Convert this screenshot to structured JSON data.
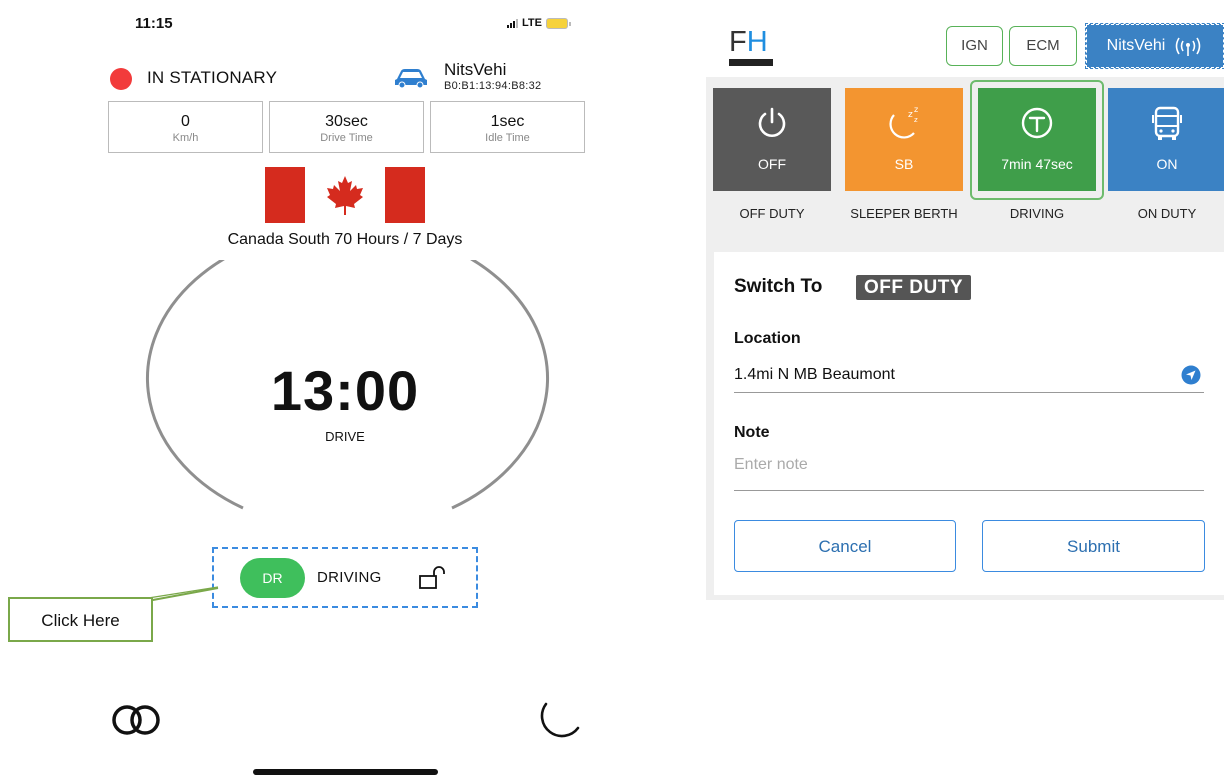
{
  "phone": {
    "status_bar": {
      "time": "11:15",
      "network": "LTE"
    },
    "vehicle_status": "IN STATIONARY",
    "vehicle": {
      "name": "NitsVehi",
      "mac": "B0:B1:13:94:B8:32"
    },
    "metrics": [
      {
        "value": "0",
        "label": "Km/h"
      },
      {
        "value": "30sec",
        "label": "Drive Time"
      },
      {
        "value": "1sec",
        "label": "Idle Time"
      }
    ],
    "ruleset": "Canada South 70 Hours / 7 Days",
    "clock": {
      "value": "13:00",
      "label": "DRIVE"
    },
    "duty_status": {
      "badge": "DR",
      "label": "DRIVING"
    },
    "callout": "Click Here"
  },
  "panel": {
    "logo": {
      "f": "F",
      "h": "H"
    },
    "pills": {
      "ign": "IGN",
      "ecm": "ECM",
      "vehicle": "NitsVehi"
    },
    "tiles": [
      {
        "text": "OFF",
        "caption": "OFF DUTY",
        "color": "#595959",
        "icon": "power-icon"
      },
      {
        "text": "SB",
        "caption": "SLEEPER BERTH",
        "color": "#f39530",
        "icon": "moon-zzz-icon"
      },
      {
        "text": "7min 47sec",
        "caption": "DRIVING",
        "color": "#3f9e4a",
        "icon": "steering-wheel-icon"
      },
      {
        "text": "ON",
        "caption": "ON DUTY",
        "color": "#3b82c4",
        "icon": "bus-icon"
      }
    ],
    "form": {
      "switch_to": "Switch To",
      "target_status": "OFF DUTY",
      "location_label": "Location",
      "location_value": "1.4mi N MB Beaumont",
      "note_label": "Note",
      "note_placeholder": "Enter note",
      "cancel": "Cancel",
      "submit": "Submit"
    }
  },
  "colors": {
    "accent_blue": "#3b8be0",
    "driving_green": "#3fbf5c",
    "stationary_red": "#f23b3b",
    "flag_red": "#d52b1e"
  }
}
